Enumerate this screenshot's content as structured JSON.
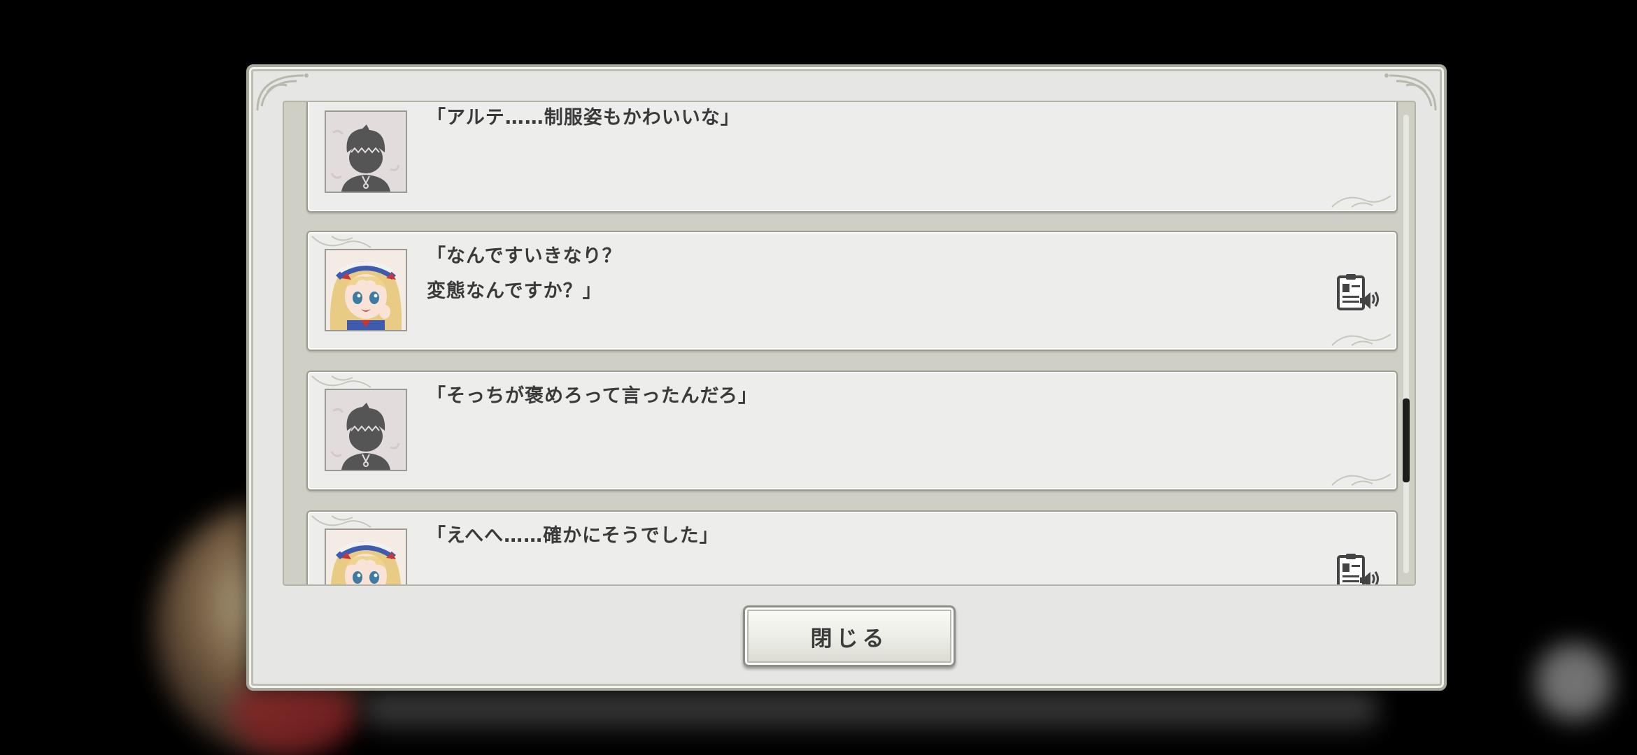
{
  "log_entries": [
    {
      "speaker": "player",
      "text": "「アルテ……制服姿もかわいいな」",
      "has_voice": false
    },
    {
      "speaker": "alte",
      "text": "「なんですいきなり？\n 変態なんですか？」",
      "has_voice": true
    },
    {
      "speaker": "player",
      "text": "「そっちが褒めろって言ったんだろ」",
      "has_voice": false
    },
    {
      "speaker": "alte",
      "text": "「えへへ……確かにそうでした」",
      "has_voice": true
    }
  ],
  "close_button": {
    "label": "閉じる"
  },
  "scroll": {
    "position_fraction": 0.62
  },
  "colors": {
    "panel": "#e6e6e4",
    "entry_bg": "#ededeb",
    "text": "#3a3a3a",
    "scroll_thumb": "#1d1d1d"
  },
  "icons": {
    "voice": "voice-playback-icon",
    "player_portrait": "player-silhouette",
    "alte_portrait": "alte-portrait"
  }
}
